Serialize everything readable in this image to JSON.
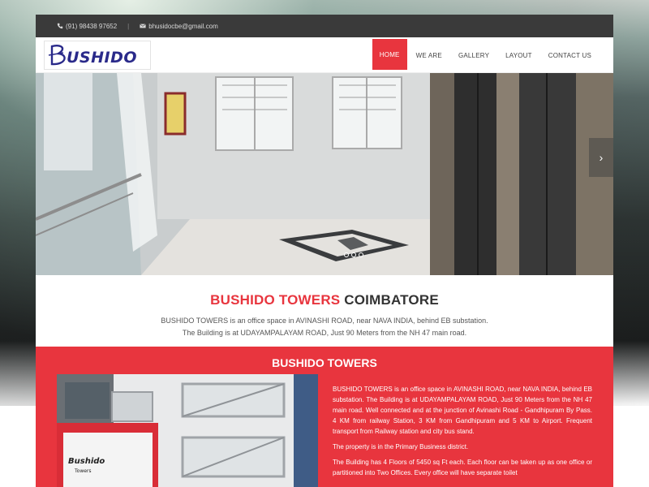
{
  "topbar": {
    "phone": "(91) 98438 97652",
    "separator": "|",
    "email": "bhusidocbe@gmail.com"
  },
  "header": {
    "logo_text": "BUSHIDO",
    "nav": [
      {
        "label": "HOME",
        "active": true
      },
      {
        "label": "WE ARE",
        "active": false
      },
      {
        "label": "GALLERY",
        "active": false
      },
      {
        "label": "LAYOUT",
        "active": false
      },
      {
        "label": "CONTACT US",
        "active": false
      }
    ]
  },
  "hero": {
    "next_arrow": "›",
    "slide_count": 3
  },
  "intro": {
    "title_red": "BUSHIDO TOWERS",
    "title_dark": "COIMBATORE",
    "line1": "BUSHIDO TOWERS is an office space in AVINASHI ROAD, near NAVA INDIA, behind EB substation.",
    "line2": "The Building is at UDAYAMPALAYAM ROAD, Just 90 Meters from the NH 47 main road."
  },
  "section": {
    "title": "BUSHIDO TOWERS",
    "photo_sign": "Bushido",
    "photo_sign_sub": "Towers",
    "para1": "BUSHIDO TOWERS is an office space in AVINASHI ROAD, near NAVA INDIA, behind EB substation. The Building is at UDAYAMPALAYAM ROAD, Just 90 Meters from the NH 47 main road. Well connected and at the junction of Avinashi Road - Gandhipuram By Pass. 4 KM from railway Station, 3 KM from Gandhipuram and 5 KM to Airport. Frequent transport from Railway station and city bus stand.",
    "para2": "The property is in the Primary Business district.",
    "para3": "The Building has 4 Floors of 5450 sq Ft each. Each floor can be taken up as one office or partitioned into Two Offices. Every office will have separate toilet"
  },
  "colors": {
    "accent": "#e8353e",
    "topbar": "#3a3a3a",
    "logo_blue": "#2a2a8a"
  }
}
